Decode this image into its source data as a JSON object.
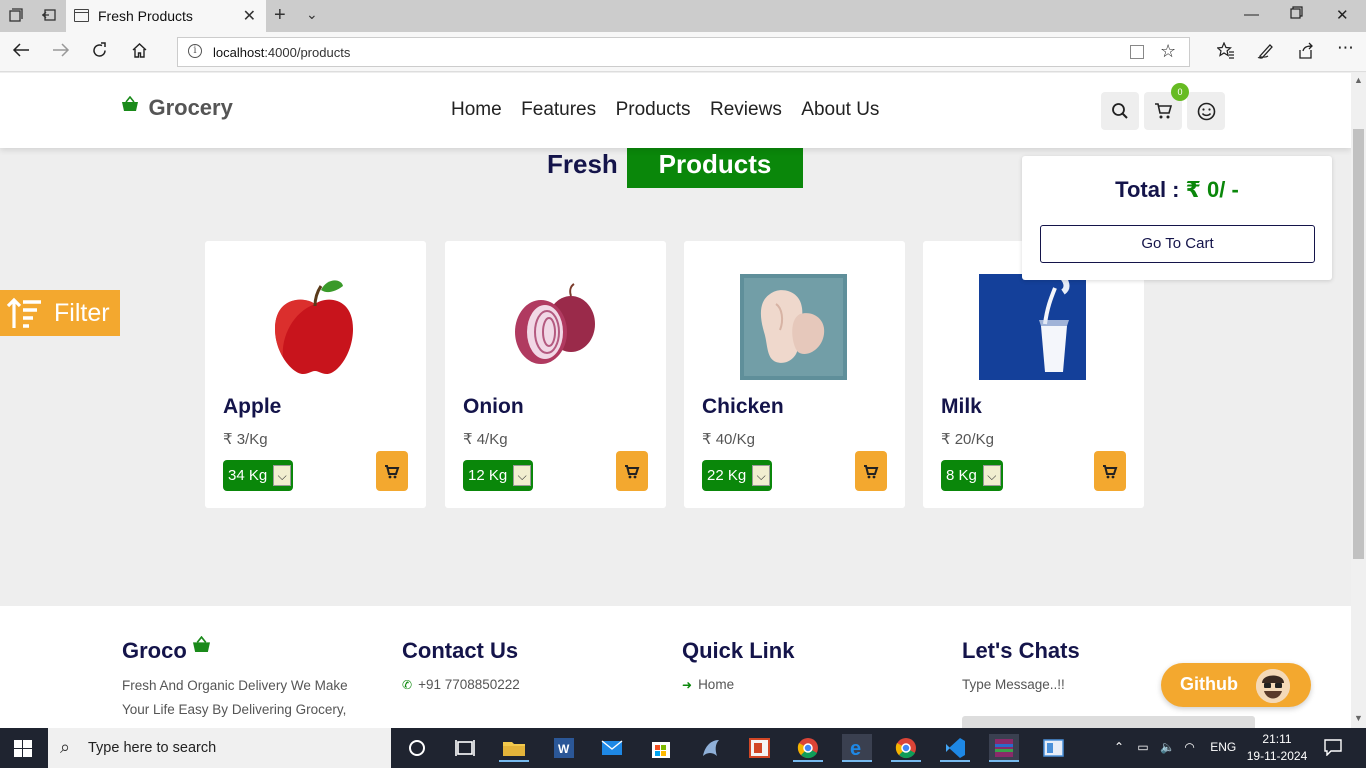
{
  "browser": {
    "tab_title": "Fresh Products",
    "url": "localhost:4000/products",
    "url_host": "localhost",
    "url_rest": ":4000/products"
  },
  "header": {
    "logo": "Grocery",
    "nav": [
      "Home",
      "Features",
      "Products",
      "Reviews",
      "About Us"
    ],
    "cart_count": "0"
  },
  "heading": {
    "part1": "Fresh",
    "part2": "Products"
  },
  "filter_label": "Filter",
  "products": [
    {
      "name": "Apple",
      "price": "₹ 3/Kg",
      "qty": "34 Kg"
    },
    {
      "name": "Onion",
      "price": "₹ 4/Kg",
      "qty": "12 Kg"
    },
    {
      "name": "Chicken",
      "price": "₹ 40/Kg",
      "qty": "22 Kg"
    },
    {
      "name": "Milk",
      "price": "₹ 20/Kg",
      "qty": "8 Kg"
    }
  ],
  "cart_popup": {
    "total_label": "Total :",
    "total_value": "₹ 0/ -",
    "button": "Go To Cart"
  },
  "footer": {
    "brand": "Groco",
    "about": "Fresh And Organic Delivery We Make Your Life Easy By Delivering Grocery,",
    "contact_title": "Contact Us",
    "phone": "+91 7708850222",
    "quick_title": "Quick Link",
    "quick_first": "Home",
    "chat_title": "Let's Chats",
    "chat_placeholder": "Type Message..!!"
  },
  "github_label": "Github",
  "taskbar": {
    "search_placeholder": "Type here to search",
    "lang": "ENG",
    "time": "21:11",
    "date": "19-11-2024"
  },
  "colors": {
    "green": "#0a870a",
    "orange": "#f3a82f",
    "navy": "#14144a"
  }
}
